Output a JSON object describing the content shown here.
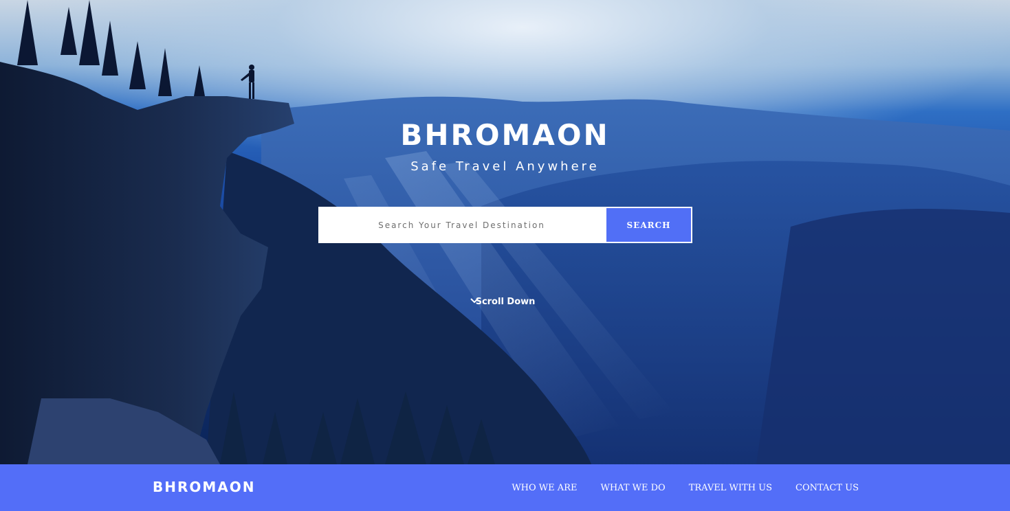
{
  "hero": {
    "title": "BHROMAON",
    "tagline": "Safe Travel Anywhere",
    "search": {
      "placeholder": "Search Your Travel Destination",
      "button_label": "SEARCH",
      "button_icon": "search-icon"
    },
    "scroll_down": {
      "label": "Scroll Down",
      "icon": "chevron-down-icon"
    }
  },
  "navbar": {
    "logo": "BHROMAON",
    "links": [
      "WHO WE ARE",
      "WHAT WE DO",
      "TRAVEL WITH US",
      "CONTACT US"
    ]
  },
  "colors": {
    "accent": "#536ef8",
    "text_light": "#ffffff"
  }
}
